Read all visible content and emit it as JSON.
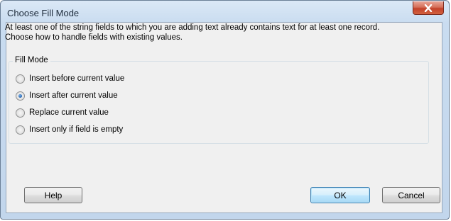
{
  "dialog": {
    "title": "Choose Fill Mode",
    "close_icon": "close-icon",
    "message_line1": "At least one of the string fields to which you are adding text already contains text for at least one record.",
    "message_line2": "Choose how to handle fields with existing values."
  },
  "fill_mode": {
    "label": "Fill Mode",
    "options": [
      {
        "label": "Insert before current value",
        "checked": false
      },
      {
        "label": "Insert after current value",
        "checked": true
      },
      {
        "label": "Replace current value",
        "checked": false
      },
      {
        "label": "Insert only if field is empty",
        "checked": false
      }
    ]
  },
  "buttons": {
    "help": "Help",
    "ok": "OK",
    "cancel": "Cancel"
  },
  "colors": {
    "accent": "#3c7fb1",
    "close_button": "#c3412a"
  }
}
